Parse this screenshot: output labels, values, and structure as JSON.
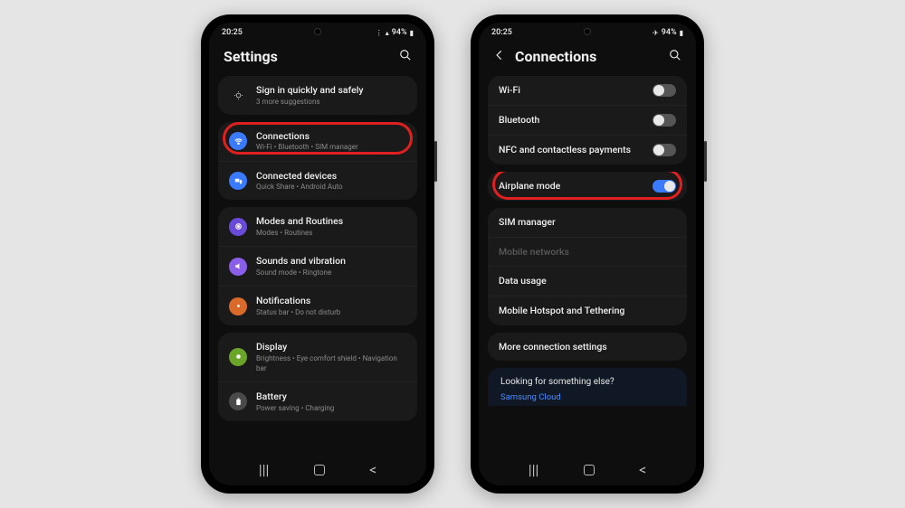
{
  "phone1": {
    "status": {
      "time": "20:25",
      "battery": "94%"
    },
    "header": {
      "title": "Settings"
    },
    "signin": {
      "title": "Sign in quickly and safely",
      "sub": "3 more suggestions"
    },
    "groups": [
      {
        "items": [
          {
            "id": "connections",
            "label": "Connections",
            "sub": "Wi-Fi • Bluetooth • SIM manager",
            "iconColor": "#3a7afe",
            "highlight": true
          },
          {
            "id": "connected-devices",
            "label": "Connected devices",
            "sub": "Quick Share • Android Auto",
            "iconColor": "#3a7afe"
          }
        ]
      },
      {
        "items": [
          {
            "id": "modes-routines",
            "label": "Modes and Routines",
            "sub": "Modes • Routines",
            "iconColor": "#6a4ad9"
          },
          {
            "id": "sounds-vibration",
            "label": "Sounds and vibration",
            "sub": "Sound mode • Ringtone",
            "iconColor": "#8a5ee8"
          },
          {
            "id": "notifications",
            "label": "Notifications",
            "sub": "Status bar • Do not disturb",
            "iconColor": "#d96a2a"
          }
        ]
      },
      {
        "items": [
          {
            "id": "display",
            "label": "Display",
            "sub": "Brightness • Eye comfort shield • Navigation bar",
            "iconColor": "#6aa52a"
          },
          {
            "id": "battery",
            "label": "Battery",
            "sub": "Power saving • Charging",
            "iconColor": "#4a4a4a"
          }
        ]
      }
    ]
  },
  "phone2": {
    "status": {
      "time": "20:25",
      "battery": "94%"
    },
    "header": {
      "title": "Connections"
    },
    "groups": [
      {
        "items": [
          {
            "id": "wifi",
            "label": "Wi-Fi",
            "toggle": false
          },
          {
            "id": "bluetooth",
            "label": "Bluetooth",
            "toggle": false
          },
          {
            "id": "nfc",
            "label": "NFC and contactless payments",
            "toggle": false
          }
        ]
      },
      {
        "items": [
          {
            "id": "airplane",
            "label": "Airplane mode",
            "toggle": true,
            "highlight": true
          }
        ]
      },
      {
        "items": [
          {
            "id": "sim-manager",
            "label": "SIM manager"
          },
          {
            "id": "mobile-networks",
            "label": "Mobile networks",
            "disabled": true
          },
          {
            "id": "data-usage",
            "label": "Data usage"
          },
          {
            "id": "hotspot",
            "label": "Mobile Hotspot and Tethering"
          }
        ]
      },
      {
        "items": [
          {
            "id": "more-conn",
            "label": "More connection settings"
          }
        ]
      }
    ],
    "footer": {
      "question": "Looking for something else?",
      "link": "Samsung Cloud"
    }
  }
}
